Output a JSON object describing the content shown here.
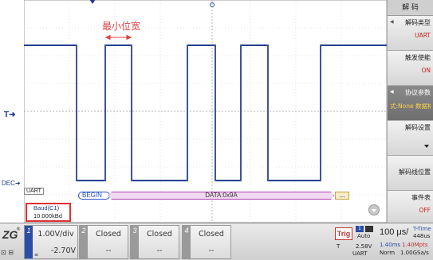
{
  "screen": {
    "annotation": "最小位宽",
    "markers": {
      "t": "T",
      "dec": "DEC"
    },
    "decode": {
      "protocol_tag": "UART",
      "begin": "BEGIN",
      "data": "DATA:0x9A",
      "end": "..."
    },
    "baud": {
      "label": "Baud(C1)",
      "value": "10.000kBd"
    }
  },
  "menu": {
    "title": "解 码",
    "items": [
      {
        "key": "解码类型",
        "value": "UART"
      },
      {
        "key": "触发使能",
        "value": "ON"
      },
      {
        "key": "协议参数",
        "value": "式:None 数据格"
      },
      {
        "key": "解码设置",
        "value": ""
      },
      {
        "key": "解码线位置",
        "value": ""
      },
      {
        "key": "事件表",
        "value": "OFF"
      }
    ]
  },
  "bottom": {
    "logo": "ZG",
    "channels": [
      {
        "num": "1",
        "line1": "1.00V/div",
        "line2": "-2.70V",
        "state": "on"
      },
      {
        "num": "2",
        "line1": "Closed",
        "line2": "--",
        "state": "off"
      },
      {
        "num": "3",
        "line1": "Closed",
        "line2": "--",
        "state": "off"
      },
      {
        "num": "4",
        "line1": "Closed",
        "line2": "--",
        "state": "off"
      }
    ],
    "trigger": {
      "label": "Trig",
      "source": "1",
      "sweep": "Auto",
      "t_label": "T",
      "level": "2.58V",
      "protocol": "UART"
    },
    "timebase": {
      "div": "100 μs/",
      "title": "T-Time",
      "value": "448us",
      "span": "1.40ms",
      "points": "1.40Mpts",
      "mode": "Norm",
      "rate": "1.00GSa/s"
    }
  },
  "colors": {
    "trace": "#1f3c8c",
    "annotation": "#e04040",
    "channel_active": "#2a4da8",
    "highlight": "#e03030"
  }
}
